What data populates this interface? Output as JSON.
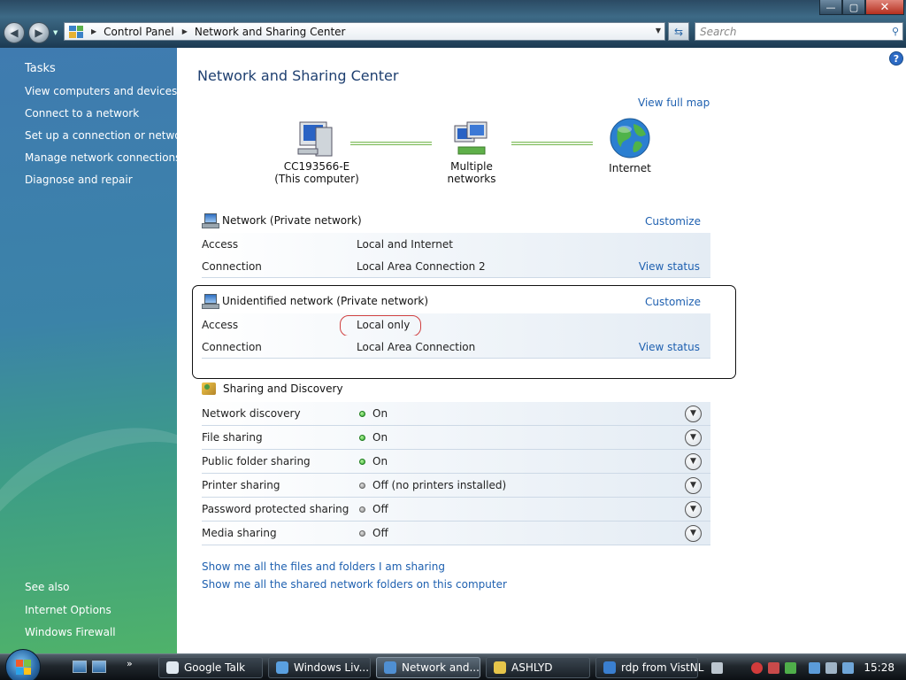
{
  "window": {
    "controls": {
      "minimize": "—",
      "maximize": "▢",
      "close": "✕"
    }
  },
  "navigation": {
    "back_icon": "back-arrow-icon",
    "forward_icon": "forward-arrow-icon",
    "breadcrumb": [
      "Control Panel",
      "Network and Sharing Center"
    ],
    "search_placeholder": "Search"
  },
  "sidebar": {
    "tasks_heading": "Tasks",
    "tasks": [
      "View computers and devices",
      "Connect to a network",
      "Set up a connection or network",
      "Manage network connections",
      "Diagnose and repair"
    ],
    "see_also_heading": "See also",
    "see_also": [
      "Internet Options",
      "Windows Firewall"
    ]
  },
  "main": {
    "title": "Network and Sharing Center",
    "view_full_map": "View full map",
    "map": {
      "computer_name": "CC193566-E",
      "computer_note": "(This computer)",
      "middle": "Multiple networks",
      "internet": "Internet"
    },
    "networks": [
      {
        "name": "Network (Private network)",
        "customize": "Customize",
        "access_label": "Access",
        "access_value": "Local and Internet",
        "connection_label": "Connection",
        "connection_value": "Local Area Connection 2",
        "view_status": "View status"
      },
      {
        "name": "Unidentified network (Private network)",
        "customize": "Customize",
        "access_label": "Access",
        "access_value": "Local only",
        "connection_label": "Connection",
        "connection_value": "Local Area Connection",
        "view_status": "View status"
      }
    ],
    "sharing": {
      "title": "Sharing and Discovery",
      "rows": [
        {
          "label": "Network discovery",
          "value": "On",
          "state": "on"
        },
        {
          "label": "File sharing",
          "value": "On",
          "state": "on"
        },
        {
          "label": "Public folder sharing",
          "value": "On",
          "state": "on"
        },
        {
          "label": "Printer sharing",
          "value": "Off (no printers installed)",
          "state": "off"
        },
        {
          "label": "Password protected sharing",
          "value": "Off",
          "state": "off"
        },
        {
          "label": "Media sharing",
          "value": "Off",
          "state": "off"
        }
      ]
    },
    "bottom_links": [
      "Show me all the files and folders I am sharing",
      "Show me all the shared network folders on this computer"
    ]
  },
  "taskbar": {
    "quick_launch_more": "»",
    "tasks": [
      {
        "label": "Google Talk",
        "active": false,
        "color": "#dfe8f0"
      },
      {
        "label": "Windows Liv...",
        "active": false,
        "color": "#5aa0e0"
      },
      {
        "label": "Network and...",
        "active": true,
        "color": "#4f8fd2"
      },
      {
        "label": "ASHLYD",
        "active": false,
        "color": "#e6c54a"
      },
      {
        "label": "rdp from Vist...",
        "active": false,
        "color": "#3a7fd0"
      }
    ],
    "language": "NL",
    "clock": "15:28"
  },
  "colors": {
    "link": "#1e60b0",
    "title": "#1e3f70",
    "status_on": "#2da82b",
    "status_off": "#8c8c8c",
    "highlight_oval": "#d04040"
  }
}
